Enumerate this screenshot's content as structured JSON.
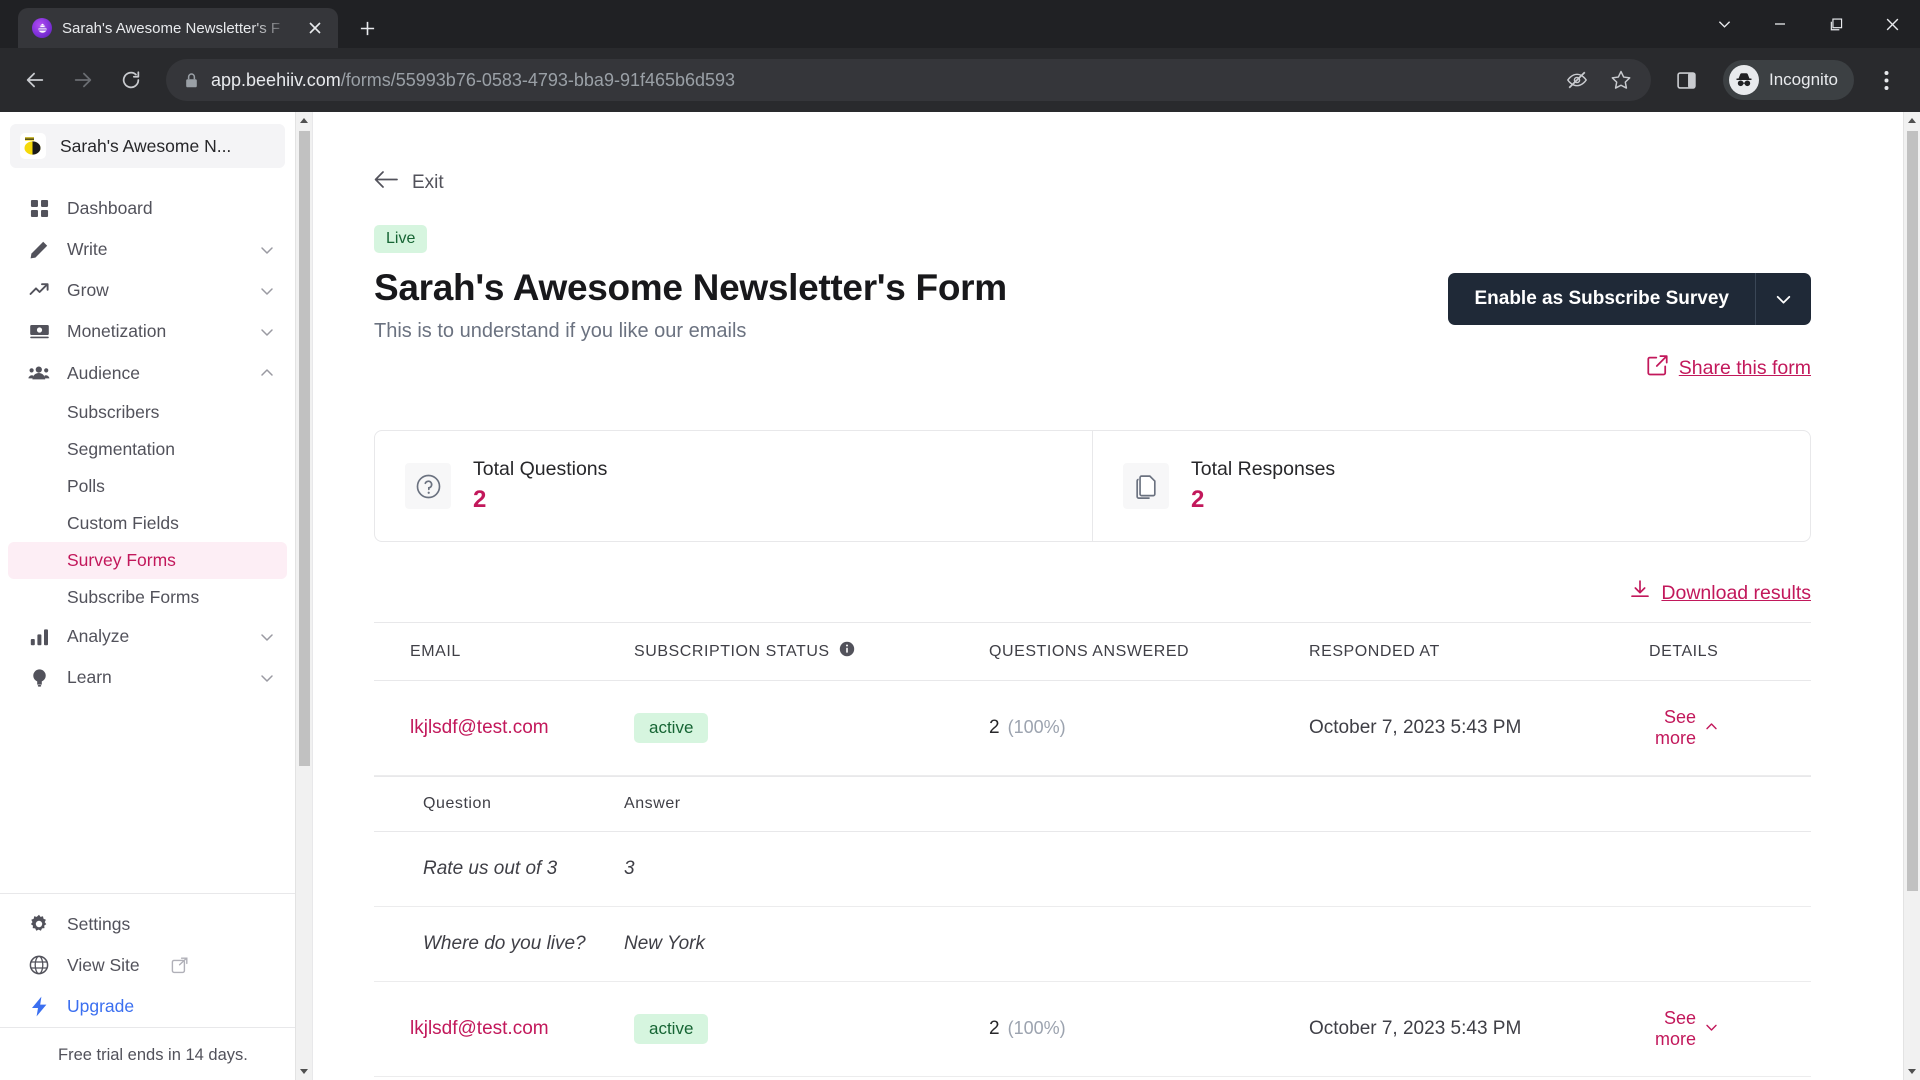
{
  "browser": {
    "tab": {
      "title": "Sarah's Awesome Newsletter's F",
      "favicon": "beehiiv-logo-icon",
      "close": "close-tab-icon"
    },
    "new_tab": "new-tab-icon",
    "window_controls": [
      "tab-search-icon",
      "minimize-icon",
      "maximize-icon",
      "close-window-icon"
    ],
    "url_domain": "app.beehiiv.com",
    "url_path": "/forms/55993b76-0583-4793-bba9-91f465b6d593",
    "profile_label": "Incognito",
    "accent": "#c2185b"
  },
  "sidebar": {
    "workspace": "Sarah's Awesome N...",
    "items": [
      {
        "label": "Dashboard",
        "icon": "grid-icon",
        "expandable": false
      },
      {
        "label": "Write",
        "icon": "pencil-icon",
        "expandable": true,
        "chevron": "down"
      },
      {
        "label": "Grow",
        "icon": "trending-up-icon",
        "expandable": true,
        "chevron": "down"
      },
      {
        "label": "Monetization",
        "icon": "banknote-icon",
        "expandable": true,
        "chevron": "down"
      },
      {
        "label": "Audience",
        "icon": "users-icon",
        "expandable": true,
        "chevron": "up"
      }
    ],
    "audience_children": [
      {
        "label": "Subscribers",
        "active": false
      },
      {
        "label": "Segmentation",
        "active": false
      },
      {
        "label": "Polls",
        "active": false
      },
      {
        "label": "Custom Fields",
        "active": false
      },
      {
        "label": "Survey Forms",
        "active": true
      },
      {
        "label": "Subscribe Forms",
        "active": false
      }
    ],
    "items_after": [
      {
        "label": "Analyze",
        "icon": "bar-chart-icon",
        "expandable": true,
        "chevron": "down"
      },
      {
        "label": "Learn",
        "icon": "lightbulb-icon",
        "expandable": true,
        "chevron": "down"
      }
    ],
    "bottom_items": [
      {
        "label": "Settings",
        "icon": "gear-icon"
      },
      {
        "label": "View Site",
        "icon": "globe-icon",
        "external": "external-link-icon"
      },
      {
        "label": "Upgrade",
        "icon": "bolt-icon",
        "highlight": "#3b6ff0"
      }
    ],
    "trial_notice": "Free trial ends in 14 days."
  },
  "page": {
    "exit_label": "Exit",
    "status_badge": "Live",
    "title": "Sarah's Awesome Newsletter's Form",
    "subtitle": "This is to understand if you like our emails",
    "primary_button": "Enable as Subscribe Survey",
    "primary_button_caret": "chevron-down-icon",
    "share_link": "Share this form",
    "download_link": "Download results"
  },
  "stats": [
    {
      "icon": "question-circle-icon",
      "label": "Total Questions",
      "value": "2"
    },
    {
      "icon": "documents-icon",
      "label": "Total Responses",
      "value": "2"
    }
  ],
  "table": {
    "headers": [
      "EMAIL",
      "SUBSCRIPTION STATUS",
      "QUESTIONS ANSWERED",
      "RESPONDED AT",
      "DETAILS"
    ],
    "status_info_icon": "info-icon",
    "rows": [
      {
        "email": "lkjlsdf@test.com",
        "status": "active",
        "answered": "2",
        "percent": "(100%)",
        "responded_at": "October 7, 2023 5:43 PM",
        "details_label": "See more",
        "expanded": true,
        "detail_headers": [
          "Question",
          "Answer"
        ],
        "detail_rows": [
          {
            "question": "Rate us out of 3",
            "answer": "3"
          },
          {
            "question": "Where do you live?",
            "answer": "New York"
          }
        ]
      },
      {
        "email": "lkjlsdf@test.com",
        "status": "active",
        "answered": "2",
        "percent": "(100%)",
        "responded_at": "October 7, 2023 5:43 PM",
        "details_label": "See more",
        "expanded": false,
        "detail_headers": [],
        "detail_rows": []
      }
    ]
  }
}
